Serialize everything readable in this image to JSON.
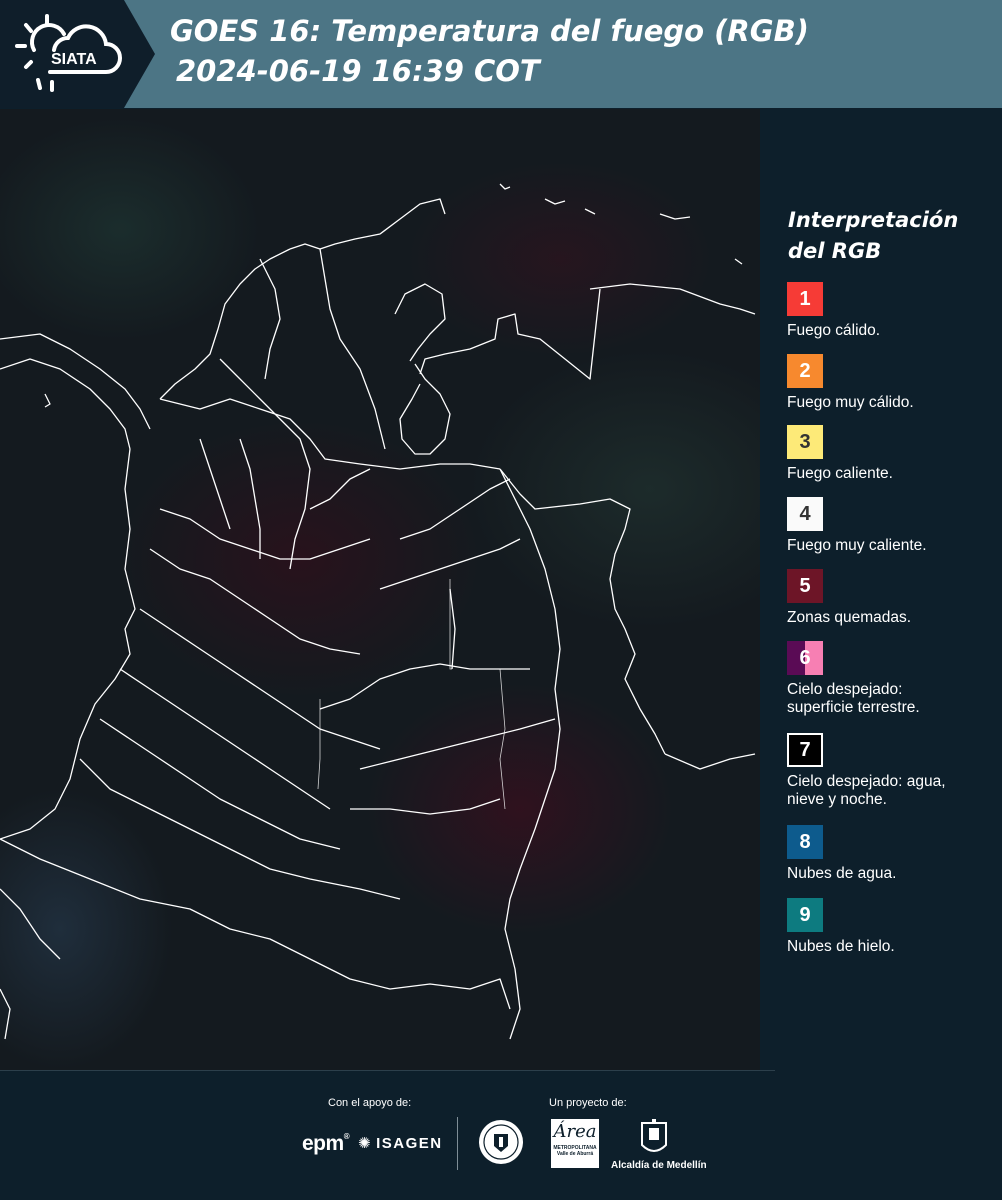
{
  "header": {
    "logo_text": "SIATA",
    "title_line1": "GOES 16: Temperatura del fuego (RGB)",
    "title_line2": "2024-06-19 16:39 COT",
    "bg_color": "#4c7585"
  },
  "map": {
    "description_icon": "satellite-map-colombia",
    "border_color": "#ffffff"
  },
  "legend": {
    "title": "Interpretación del RGB",
    "items": [
      {
        "number": "1",
        "label": "Fuego cálido.",
        "color": "#f63b36"
      },
      {
        "number": "2",
        "label": "Fuego muy cálido.",
        "color": "#f7892e"
      },
      {
        "number": "3",
        "label": "Fuego caliente.",
        "color": "#fdea78"
      },
      {
        "number": "4",
        "label": "Fuego muy caliente.",
        "color": "#fafafa"
      },
      {
        "number": "5",
        "label": "Zonas quemadas.",
        "color": "#6d1527"
      },
      {
        "number": "6",
        "label": "Cielo despejado: superficie terrestre.",
        "color": "#5a0b55",
        "color2": "#f77fb3"
      },
      {
        "number": "7",
        "label": "Cielo despejado: agua, nieve y noche.",
        "color": "#000000"
      },
      {
        "number": "8",
        "label": "Nubes de agua.",
        "color": "#0d5b8d"
      },
      {
        "number": "9",
        "label": "Nubes de hielo.",
        "color": "#0d7b80"
      }
    ]
  },
  "footer": {
    "support_label": "Con el apoyo de:",
    "project_label": "Un proyecto de:",
    "epm": "epm",
    "isagen": "ISAGEN",
    "area_word": "Área",
    "area_sub": "METROPOLITANA Valle de Aburrá",
    "alcaldia": "Alcaldía de Medellín"
  }
}
